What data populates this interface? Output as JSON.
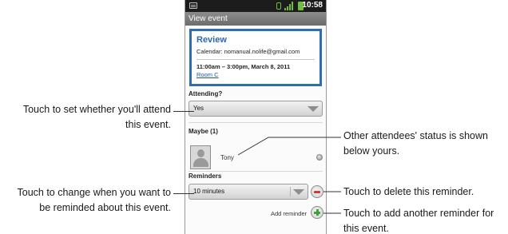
{
  "status_bar": {
    "time": "10:58"
  },
  "title_bar": {
    "title": "View event"
  },
  "event": {
    "title": "Review",
    "calendar": "Calendar: nomanual.nolife@gmail.com",
    "time": "11:00am – 3:00pm, March 8, 2011",
    "room": "Room C"
  },
  "attending": {
    "label": "Attending?",
    "value": "Yes"
  },
  "maybe": {
    "label": "Maybe (1)",
    "attendee": "Tony"
  },
  "reminders": {
    "label": "Reminders",
    "value": "10 minutes",
    "add_label": "Add reminder"
  },
  "callouts": {
    "attend_1": "Touch to set whether you'll attend",
    "attend_2": "this event.",
    "others_1": "Other attendees' status is shown",
    "others_2": "below yours.",
    "change_1": "Touch to change when you want to",
    "change_2": "be reminded about this event.",
    "delete": "Touch to delete this reminder.",
    "add_1": "Touch to add another reminder for",
    "add_2": "this event."
  }
}
